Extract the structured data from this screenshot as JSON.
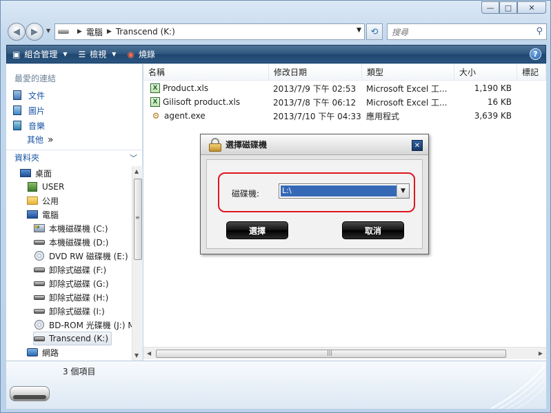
{
  "window": {
    "caption_min": "—",
    "caption_max": "□",
    "caption_close": "✕"
  },
  "address": {
    "segments": [
      "電腦",
      "Transcend (K:)"
    ],
    "search_placeholder": "搜尋"
  },
  "toolbar": {
    "organize": "組合管理",
    "views": "檢視",
    "burn": "燒錄",
    "help": "?"
  },
  "favorites": {
    "title": "最愛的連結",
    "items": [
      "文件",
      "圖片",
      "音樂"
    ],
    "more": "其他"
  },
  "folders": {
    "title": "資料夾",
    "tree": [
      {
        "label": "桌面",
        "icon": "monitor"
      },
      {
        "label": "USER",
        "icon": "user"
      },
      {
        "label": "公用",
        "icon": "folder"
      },
      {
        "label": "電腦",
        "icon": "computer"
      },
      {
        "label": "本機磁碟機 (C:)",
        "icon": "system-drive"
      },
      {
        "label": "本機磁碟機 (D:)",
        "icon": "drive"
      },
      {
        "label": "DVD RW 磁碟機 (E:)",
        "icon": "disc"
      },
      {
        "label": "卸除式磁碟 (F:)",
        "icon": "drive"
      },
      {
        "label": "卸除式磁碟 (G:)",
        "icon": "drive"
      },
      {
        "label": "卸除式磁碟 (H:)",
        "icon": "drive"
      },
      {
        "label": "卸除式磁碟 (I:)",
        "icon": "drive"
      },
      {
        "label": "BD-ROM 光碟機 (J:) M",
        "icon": "disc"
      },
      {
        "label": "Transcend (K:)",
        "icon": "drive",
        "selected": true
      },
      {
        "label": "網路",
        "icon": "network"
      }
    ]
  },
  "list": {
    "columns": [
      "名稱",
      "修改日期",
      "類型",
      "大小",
      "標記"
    ],
    "rows": [
      {
        "name": "Product.xls",
        "date": "2013/7/9 下午 02:53",
        "type": "Microsoft Excel 工...",
        "size": "1,190 KB",
        "icon": "xls"
      },
      {
        "name": "Gilisoft product.xls",
        "date": "2013/7/8 下午 06:12",
        "type": "Microsoft Excel 工...",
        "size": "16 KB",
        "icon": "xls"
      },
      {
        "name": "agent.exe",
        "date": "2013/7/10 下午 04:33",
        "type": "應用程式",
        "size": "3,639 KB",
        "icon": "exe"
      }
    ]
  },
  "details": {
    "count": "3 個項目"
  },
  "dialog": {
    "title": "選擇磁碟機",
    "close": "✕",
    "label": "磁碟機:",
    "selected_drive": "L:\\",
    "ok": "選擇",
    "cancel": "取消"
  }
}
